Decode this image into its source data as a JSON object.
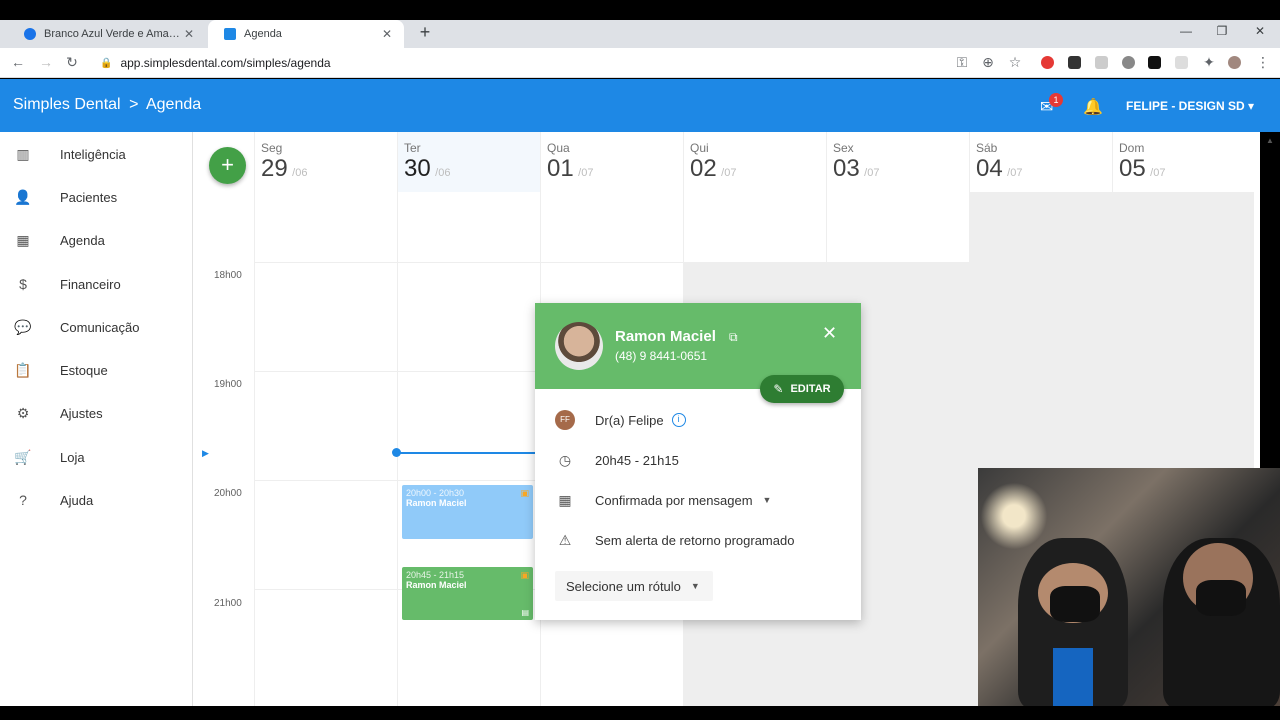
{
  "browser": {
    "tabs": [
      {
        "title": "Branco Azul Verde e Amarelo M...",
        "active": false
      },
      {
        "title": "Agenda",
        "active": true
      }
    ],
    "url": "app.simplesdental.com/simples/agenda"
  },
  "header": {
    "app_name": "Simples Dental",
    "separator": ">",
    "section": "Agenda",
    "notification_count": "1",
    "user": "FELIPE - DESIGN SD"
  },
  "sidebar": {
    "items": [
      {
        "label": "Inteligência",
        "icon": "bar-chart-icon"
      },
      {
        "label": "Pacientes",
        "icon": "person-icon"
      },
      {
        "label": "Agenda",
        "icon": "calendar-icon"
      },
      {
        "label": "Financeiro",
        "icon": "dollar-icon"
      },
      {
        "label": "Comunicação",
        "icon": "chat-icon"
      },
      {
        "label": "Estoque",
        "icon": "clipboard-icon"
      },
      {
        "label": "Ajustes",
        "icon": "gear-icon"
      },
      {
        "label": "Loja",
        "icon": "cart-icon"
      },
      {
        "label": "Ajuda",
        "icon": "help-icon"
      }
    ]
  },
  "calendar": {
    "fab": "+",
    "days": [
      {
        "name": "Seg",
        "num": "29",
        "month": "/06"
      },
      {
        "name": "Ter",
        "num": "30",
        "month": "/06"
      },
      {
        "name": "Qua",
        "num": "01",
        "month": "/07"
      },
      {
        "name": "Qui",
        "num": "02",
        "month": "/07"
      },
      {
        "name": "Sex",
        "num": "03",
        "month": "/07"
      },
      {
        "name": "Sáb",
        "num": "04",
        "month": "/07"
      },
      {
        "name": "Dom",
        "num": "05",
        "month": "/07"
      }
    ],
    "hours": [
      "18h00",
      "19h00",
      "20h00",
      "21h00"
    ],
    "appointments": [
      {
        "time": "20h00 - 20h30",
        "patient": "Ramon Maciel",
        "color": "#90caf9"
      },
      {
        "time": "20h45 - 21h15",
        "patient": "Ramon Maciel",
        "color": "#66bb6a"
      }
    ]
  },
  "popup": {
    "patient_name": "Ramon Maciel",
    "phone": "(48) 9 8441-0651",
    "edit_label": "EDITAR",
    "doctor_initials": "FF",
    "doctor": "Dr(a) Felipe",
    "time": "20h45 - 21h15",
    "status": "Confirmada por mensagem",
    "alert": "Sem alerta de retorno programado",
    "label_select": "Selecione um rótulo",
    "header_color": "#66bb6a"
  },
  "colors": {
    "primary": "#1e88e5",
    "fab": "#43a047"
  }
}
